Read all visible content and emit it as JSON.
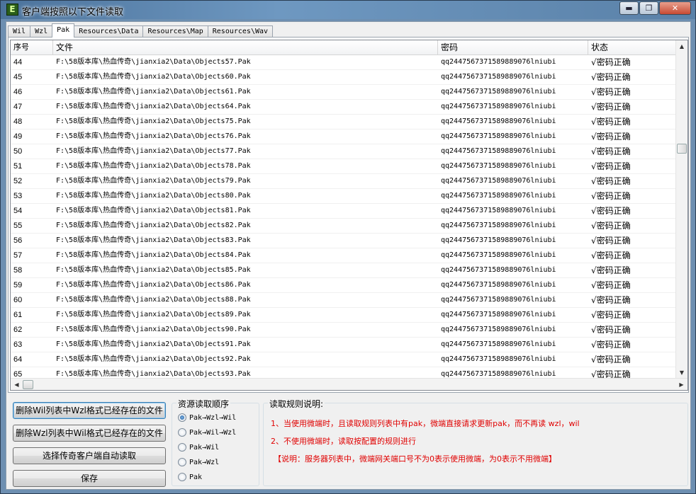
{
  "window": {
    "title": "客户端按照以下文件读取",
    "icon_letter": "E",
    "minimize_glyph": "▬",
    "maximize_glyph": "❐",
    "close_glyph": "✕"
  },
  "tabs": [
    "Wil",
    "Wzl",
    "Pak",
    "Resources\\Data",
    "Resources\\Map",
    "Resources\\Wav"
  ],
  "active_tab": "Pak",
  "list": {
    "columns": [
      "序号",
      "文件",
      "密码",
      "状态"
    ],
    "rows": [
      [
        "44",
        "F:\\58版本库\\热血传奇\\jianxia2\\Data\\Objects57.Pak",
        "qq2447567371589889076lniubi",
        "√密码正确"
      ],
      [
        "45",
        "F:\\58版本库\\热血传奇\\jianxia2\\Data\\Objects60.Pak",
        "qq2447567371589889076lniubi",
        "√密码正确"
      ],
      [
        "46",
        "F:\\58版本库\\热血传奇\\jianxia2\\Data\\Objects61.Pak",
        "qq2447567371589889076lniubi",
        "√密码正确"
      ],
      [
        "47",
        "F:\\58版本库\\热血传奇\\jianxia2\\Data\\Objects64.Pak",
        "qq2447567371589889076lniubi",
        "√密码正确"
      ],
      [
        "48",
        "F:\\58版本库\\热血传奇\\jianxia2\\Data\\Objects75.Pak",
        "qq2447567371589889076lniubi",
        "√密码正确"
      ],
      [
        "49",
        "F:\\58版本库\\热血传奇\\jianxia2\\Data\\Objects76.Pak",
        "qq2447567371589889076lniubi",
        "√密码正确"
      ],
      [
        "50",
        "F:\\58版本库\\热血传奇\\jianxia2\\Data\\Objects77.Pak",
        "qq2447567371589889076lniubi",
        "√密码正确"
      ],
      [
        "51",
        "F:\\58版本库\\热血传奇\\jianxia2\\Data\\Objects78.Pak",
        "qq2447567371589889076lniubi",
        "√密码正确"
      ],
      [
        "52",
        "F:\\58版本库\\热血传奇\\jianxia2\\Data\\Objects79.Pak",
        "qq2447567371589889076lniubi",
        "√密码正确"
      ],
      [
        "53",
        "F:\\58版本库\\热血传奇\\jianxia2\\Data\\Objects80.Pak",
        "qq2447567371589889076lniubi",
        "√密码正确"
      ],
      [
        "54",
        "F:\\58版本库\\热血传奇\\jianxia2\\Data\\Objects81.Pak",
        "qq2447567371589889076lniubi",
        "√密码正确"
      ],
      [
        "55",
        "F:\\58版本库\\热血传奇\\jianxia2\\Data\\Objects82.Pak",
        "qq2447567371589889076lniubi",
        "√密码正确"
      ],
      [
        "56",
        "F:\\58版本库\\热血传奇\\jianxia2\\Data\\Objects83.Pak",
        "qq2447567371589889076lniubi",
        "√密码正确"
      ],
      [
        "57",
        "F:\\58版本库\\热血传奇\\jianxia2\\Data\\Objects84.Pak",
        "qq2447567371589889076lniubi",
        "√密码正确"
      ],
      [
        "58",
        "F:\\58版本库\\热血传奇\\jianxia2\\Data\\Objects85.Pak",
        "qq2447567371589889076lniubi",
        "√密码正确"
      ],
      [
        "59",
        "F:\\58版本库\\热血传奇\\jianxia2\\Data\\Objects86.Pak",
        "qq2447567371589889076lniubi",
        "√密码正确"
      ],
      [
        "60",
        "F:\\58版本库\\热血传奇\\jianxia2\\Data\\Objects88.Pak",
        "qq2447567371589889076lniubi",
        "√密码正确"
      ],
      [
        "61",
        "F:\\58版本库\\热血传奇\\jianxia2\\Data\\Objects89.Pak",
        "qq2447567371589889076lniubi",
        "√密码正确"
      ],
      [
        "62",
        "F:\\58版本库\\热血传奇\\jianxia2\\Data\\Objects90.Pak",
        "qq2447567371589889076lniubi",
        "√密码正确"
      ],
      [
        "63",
        "F:\\58版本库\\热血传奇\\jianxia2\\Data\\Objects91.Pak",
        "qq2447567371589889076lniubi",
        "√密码正确"
      ],
      [
        "64",
        "F:\\58版本库\\热血传奇\\jianxia2\\Data\\Objects92.Pak",
        "qq2447567371589889076lniubi",
        "√密码正确"
      ],
      [
        "65",
        "F:\\58版本库\\热血传奇\\jianxia2\\Data\\Objects93.Pak",
        "qq2447567371589889076lniubi",
        "√密码正确"
      ]
    ]
  },
  "scroll": {
    "up_glyph": "▲",
    "down_glyph": "▼",
    "left_glyph": "◀",
    "right_glyph": "▶"
  },
  "buttons": {
    "delete_wil": "删除Wil列表中Wzl格式已经存在的文件",
    "delete_wzl": "删除Wzl列表中Wil格式已经存在的文件",
    "auto_read": "选择传奇客户端自动读取",
    "save": "保存"
  },
  "order": {
    "title": "资源读取顺序",
    "options": [
      "Pak→Wzl→Wil",
      "Pak→Wil→Wzl",
      "Pak→Wil",
      "Pak→Wzl",
      "Pak"
    ],
    "selected": "Pak→Wzl→Wil"
  },
  "rules": {
    "title": "读取规则说明:",
    "lines": [
      "1、当使用微端时，且读取规则列表中有pak，微端直接请求更新pak，而不再读 wzl，wil",
      "2、不使用微端时，读取按配置的规则进行",
      "【说明：服务器列表中，微端网关端口号不为0表示使用微端，为0表示不用微端】"
    ]
  },
  "colors": {
    "rule_text": "#e00000",
    "selection_accent": "#3c7fb1"
  }
}
